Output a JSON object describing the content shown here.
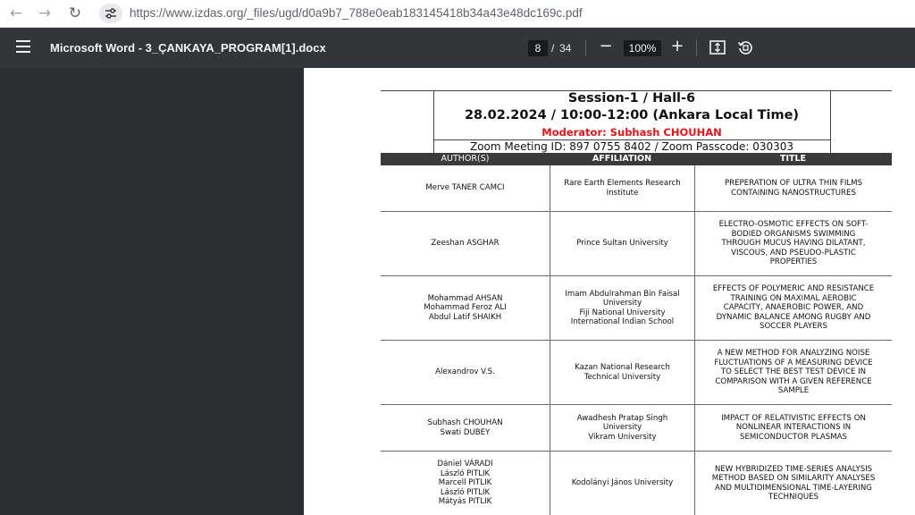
{
  "browser": {
    "url": "https://www.izdas.org/_files/ugd/d0a9b7_788e0eab183145418b34a43e48dc169c.pdf"
  },
  "viewer": {
    "title": "Microsoft Word - 3_ÇANKAYA_PROGRAM[1].docx",
    "page_current": "8",
    "page_separator": "/",
    "page_total": "34",
    "zoom": "100%"
  },
  "document": {
    "session": "Session-1 / Hall-6",
    "datetime": "28.02.2024 / 10:00-12:00 (Ankara Local Time)",
    "moderator": "Moderator: Subhash CHOUHAN",
    "zoom_info": "Zoom Meeting ID: 897 0755 8402 / Zoom Passcode: 030303",
    "columns": [
      "AUTHOR(S)",
      "AFFILIATION",
      "TITLE"
    ],
    "rows": [
      {
        "authors": "Merve TANER CAMCI",
        "affiliation": "Rare Earth Elements Research\nInstitute",
        "title": "PREPERATION OF ULTRA THIN FILMS\nCONTAINING NANOSTRUCTURES"
      },
      {
        "authors": "Zeeshan ASGHAR",
        "affiliation": "Prince Sultan University",
        "title": "ELECTRO-OSMOTIC EFFECTS ON SOFT-\nBODIED ORGANISMS SWIMMING\nTHROUGH MUCUS HAVING DILATANT,\nVISCOUS, AND PSEUDO-PLASTIC\nPROPERTIES"
      },
      {
        "authors": "Mohammad AHSAN\nMohammad Feroz ALI\nAbdul Latif SHAIKH",
        "affiliation": "Imam Abdulrahman Bin Faisal\nUniversity\nFiji National University\nInternational Indian School",
        "title": "EFFECTS OF POLYMERIC AND RESISTANCE\nTRAINING ON MAXIMAL AEROBIC\nCAPACITY, ANAEROBIC POWER, AND\nDYNAMIC BALANCE AMONG RUGBY AND\nSOCCER PLAYERS"
      },
      {
        "authors": "Alexandrov V.S.",
        "affiliation": "Kazan National Research\nTechnical University",
        "title": "A NEW METHOD FOR ANALYZING NOISE\nFLUCTUATIONS OF A MEASURING DEVICE\nTO SELECT THE BEST TEST DEVICE IN\nCOMPARISON WITH A GIVEN REFERENCE\nSAMPLE"
      },
      {
        "authors": "Subhash CHOUHAN\nSwati DUBEY",
        "affiliation": "Awadhesh Pratap Singh\nUniversity\nVikram University",
        "title": "IMPACT OF RELATIVISTIC EFFECTS ON\nNONLINEAR INTERACTIONS IN\nSEMICONDUCTOR PLASMAS"
      },
      {
        "authors": "Dániel VÁRADI\nLászló PITLIK\nMarcell PITLIK\nLászló PITLIK\nMátyás PITLIK",
        "affiliation": "Kodolányi János University",
        "title": "NEW HYBRIDIZED TIME-SERIES ANALYSIS\nMETHOD BASED ON SIMILARITY ANALYSES\nAND MULTIDIMENSIONAL TIME-LAYERING\nTECHNIQUES"
      }
    ]
  },
  "icons": {
    "back": "arrow-left-icon",
    "forward": "arrow-right-icon",
    "reload": "reload-icon",
    "site_info": "tune-icon",
    "menu": "hamburger-menu-icon",
    "zoom_out": "minus-icon",
    "zoom_in": "plus-icon",
    "fit": "fit-to-page-icon",
    "rotate": "rotate-icon"
  },
  "colors": {
    "toolbar": "#323639",
    "moderator_red": "#e8141c",
    "table_header": "#3a3a3a"
  }
}
